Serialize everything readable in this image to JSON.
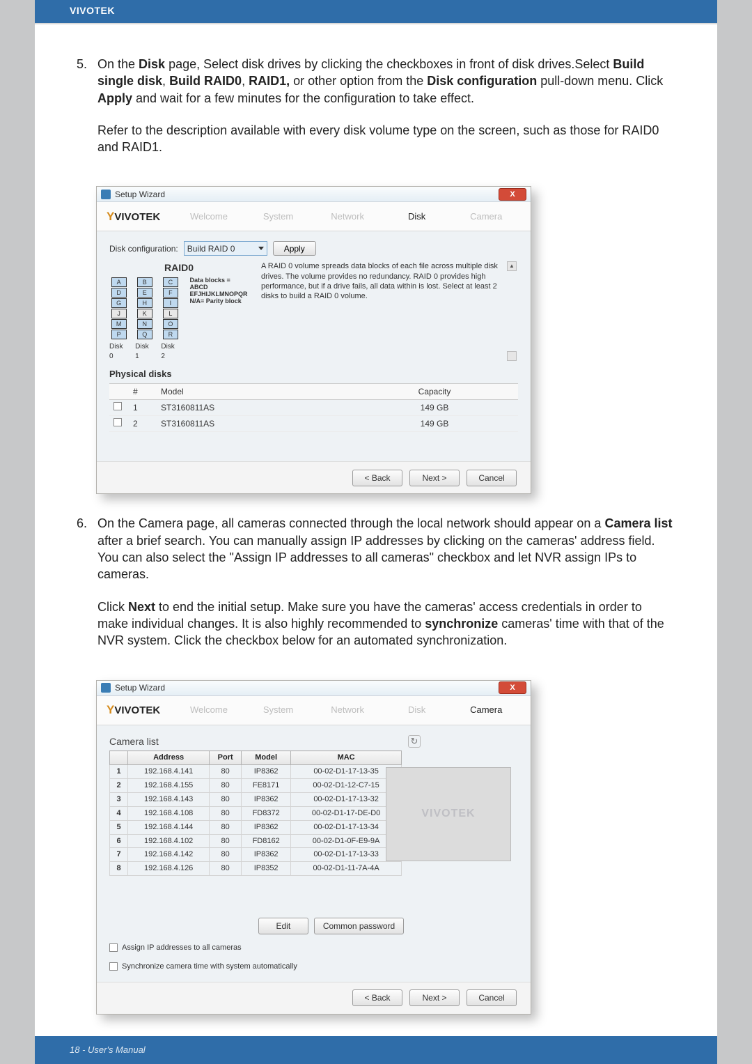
{
  "brand": "VIVOTEK",
  "step5": {
    "num": "5.",
    "para1_a": "On the ",
    "para1_b": "Disk",
    "para1_c": " page, Select disk drives by clicking the checkboxes in front of disk drives.Select ",
    "para1_d": "Build single disk",
    "para1_e": ", ",
    "para1_f": "Build RAID0",
    "para1_g": ", ",
    "para1_h": "RAID1,",
    "para1_i": " or other option from the ",
    "para1_j": "Disk configuration",
    "para1_k": " pull-down menu. Click ",
    "para1_l": "Apply",
    "para1_m": " and wait for a few minutes for the configuration to take effect.",
    "para2": "Refer to the description available with every disk volume type on the screen, such as those for RAID0 and RAID1."
  },
  "step6": {
    "num": "6.",
    "para1_a": "On the Camera page, all cameras connected through the local network should appear on a ",
    "para1_b": "Camera list",
    "para1_c": " after a brief search. You can manually assign IP addresses by clicking on the cameras' address field. You can also select the \"Assign IP addresses to all cameras\" checkbox and let NVR assign IPs to cameras.",
    "para2_a": "Click ",
    "para2_b": "Next",
    "para2_c": " to end the initial setup. Make sure you have the cameras' access credentials in order to make individual changes. It is also highly recommended to ",
    "para2_d": "synchronize",
    "para2_e": " cameras' time with that of the NVR system. Click the checkbox below for an automated synchronization."
  },
  "wizard": {
    "title": "Setup Wizard",
    "close": "X",
    "logo_y": "Y",
    "logo_rest": "VIVOTEK",
    "tabs": {
      "welcome": "Welcome",
      "system": "System",
      "network": "Network",
      "disk": "Disk",
      "camera": "Camera"
    },
    "buttons": {
      "back": "< Back",
      "next": "Next >",
      "cancel": "Cancel"
    }
  },
  "diskwiz": {
    "cfg_label": "Disk configuration:",
    "dropdown": "Build RAID 0",
    "apply": "Apply",
    "raid_title": "RAID0",
    "col0": [
      "A",
      "D",
      "G",
      "J",
      "M",
      "P"
    ],
    "col1": [
      "B",
      "E",
      "H",
      "K",
      "N",
      "Q"
    ],
    "col2": [
      "C",
      "F",
      "I",
      "L",
      "O",
      "R"
    ],
    "d0": "Disk 0",
    "d1": "Disk 1",
    "d2": "Disk 2",
    "note1": "Data blocks = ABCD",
    "note2": "EFJHIJKLMNOPQR",
    "note3": "N/A= Parity block",
    "desc": "A RAID 0 volume spreads data blocks of each file across multiple disk drives. The volume provides no redundancy. RAID 0 provides high performance, but if a drive fails, all data within is lost. Select at least 2 disks to build a RAID 0 volume.",
    "phys": "Physical disks",
    "th_num": "#",
    "th_model": "Model",
    "th_cap": "Capacity",
    "rows": [
      {
        "n": "1",
        "m": "ST3160811AS",
        "c": "149 GB"
      },
      {
        "n": "2",
        "m": "ST3160811AS",
        "c": "149 GB"
      }
    ]
  },
  "camwiz": {
    "list_title": "Camera list",
    "refresh": "↻",
    "th_addr": "Address",
    "th_port": "Port",
    "th_model": "Model",
    "th_mac": "MAC",
    "rows": [
      {
        "n": "1",
        "a": "192.168.4.141",
        "p": "80",
        "m": "IP8362",
        "mac": "00-02-D1-17-13-35"
      },
      {
        "n": "2",
        "a": "192.168.4.155",
        "p": "80",
        "m": "FE8171",
        "mac": "00-02-D1-12-C7-15"
      },
      {
        "n": "3",
        "a": "192.168.4.143",
        "p": "80",
        "m": "IP8362",
        "mac": "00-02-D1-17-13-32"
      },
      {
        "n": "4",
        "a": "192.168.4.108",
        "p": "80",
        "m": "FD8372",
        "mac": "00-02-D1-17-DE-D0"
      },
      {
        "n": "5",
        "a": "192.168.4.144",
        "p": "80",
        "m": "IP8362",
        "mac": "00-02-D1-17-13-34"
      },
      {
        "n": "6",
        "a": "192.168.4.102",
        "p": "80",
        "m": "FD8162",
        "mac": "00-02-D1-0F-E9-9A"
      },
      {
        "n": "7",
        "a": "192.168.4.142",
        "p": "80",
        "m": "IP8362",
        "mac": "00-02-D1-17-13-33"
      },
      {
        "n": "8",
        "a": "192.168.4.126",
        "p": "80",
        "m": "IP8352",
        "mac": "00-02-D1-11-7A-4A"
      }
    ],
    "watermark": "VIVOTEK",
    "edit": "Edit",
    "common": "Common password",
    "chk1": "Assign IP addresses to all cameras",
    "chk2": "Synchronize camera time with system automatically"
  },
  "footer": "18 - User's Manual"
}
